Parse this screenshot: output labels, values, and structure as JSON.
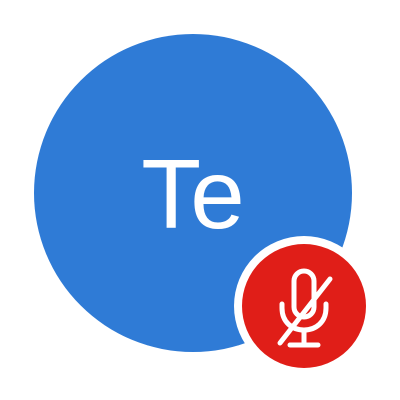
{
  "participant": {
    "initials": "Te",
    "avatar_color": "#2F7BD6"
  },
  "mute_badge": {
    "icon": "microphone-off-icon",
    "color": "#E01E18",
    "muted": true
  }
}
